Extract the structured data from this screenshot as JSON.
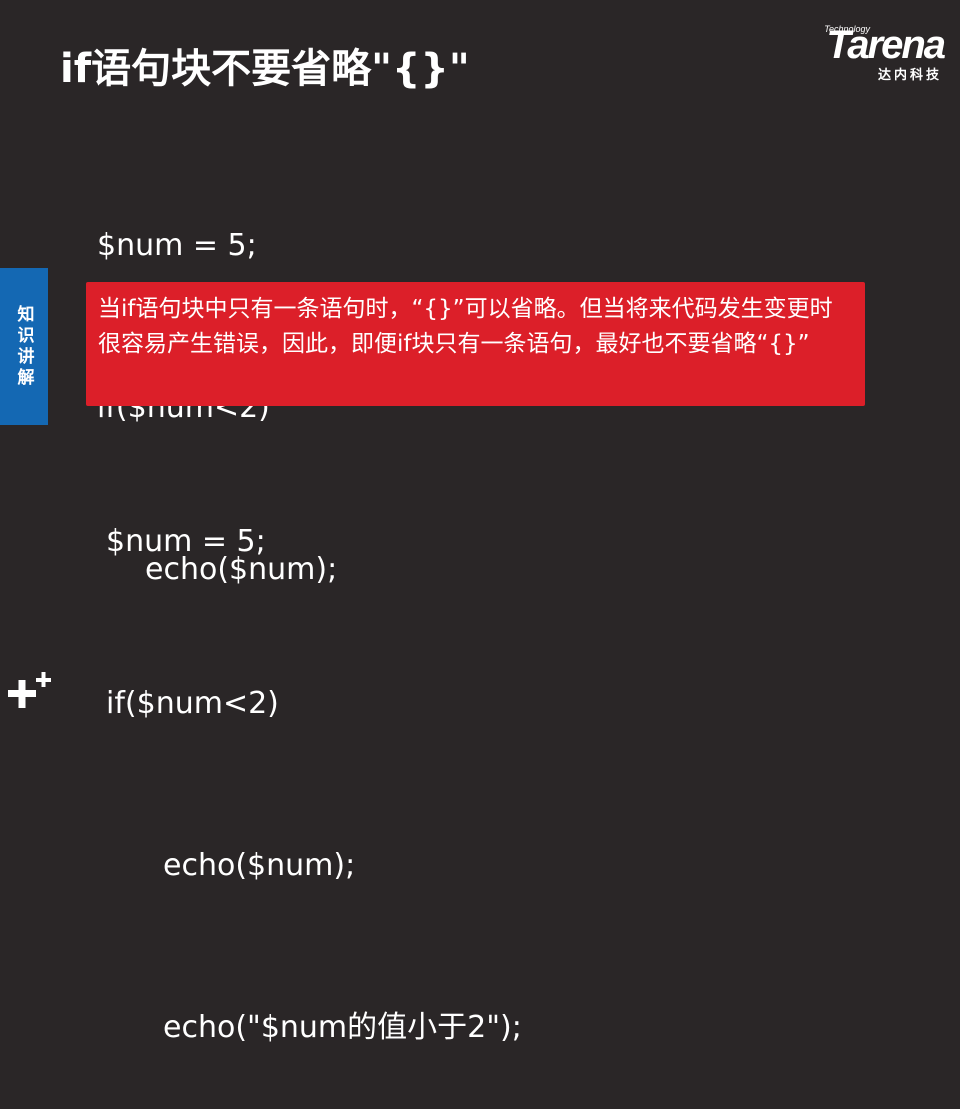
{
  "slide": {
    "title": "if语句块不要省略\"{}\"",
    "side_tab_label": "知识讲解",
    "logo": {
      "brand": "Tarena",
      "tagline": "Technology",
      "subtitle": "达内科技"
    },
    "code_top": [
      "$num = 5;",
      "if($num<2)",
      "echo($num);"
    ],
    "callout": "当if语句块中只有一条语句时，“{}”可以省略。但当将来代码发生变更时很容易产生错误，因此，即便if块只有一条语句，最好也不要省略“{}”",
    "code_bottom": [
      "$num = 5;",
      "if($num<2)",
      "echo($num);",
      "echo(\"$num的值小于2\");"
    ]
  },
  "colors": {
    "background": "#2a2627",
    "callout": "#dc1f29",
    "side_tab": "#1468b3",
    "text": "#ffffff"
  }
}
